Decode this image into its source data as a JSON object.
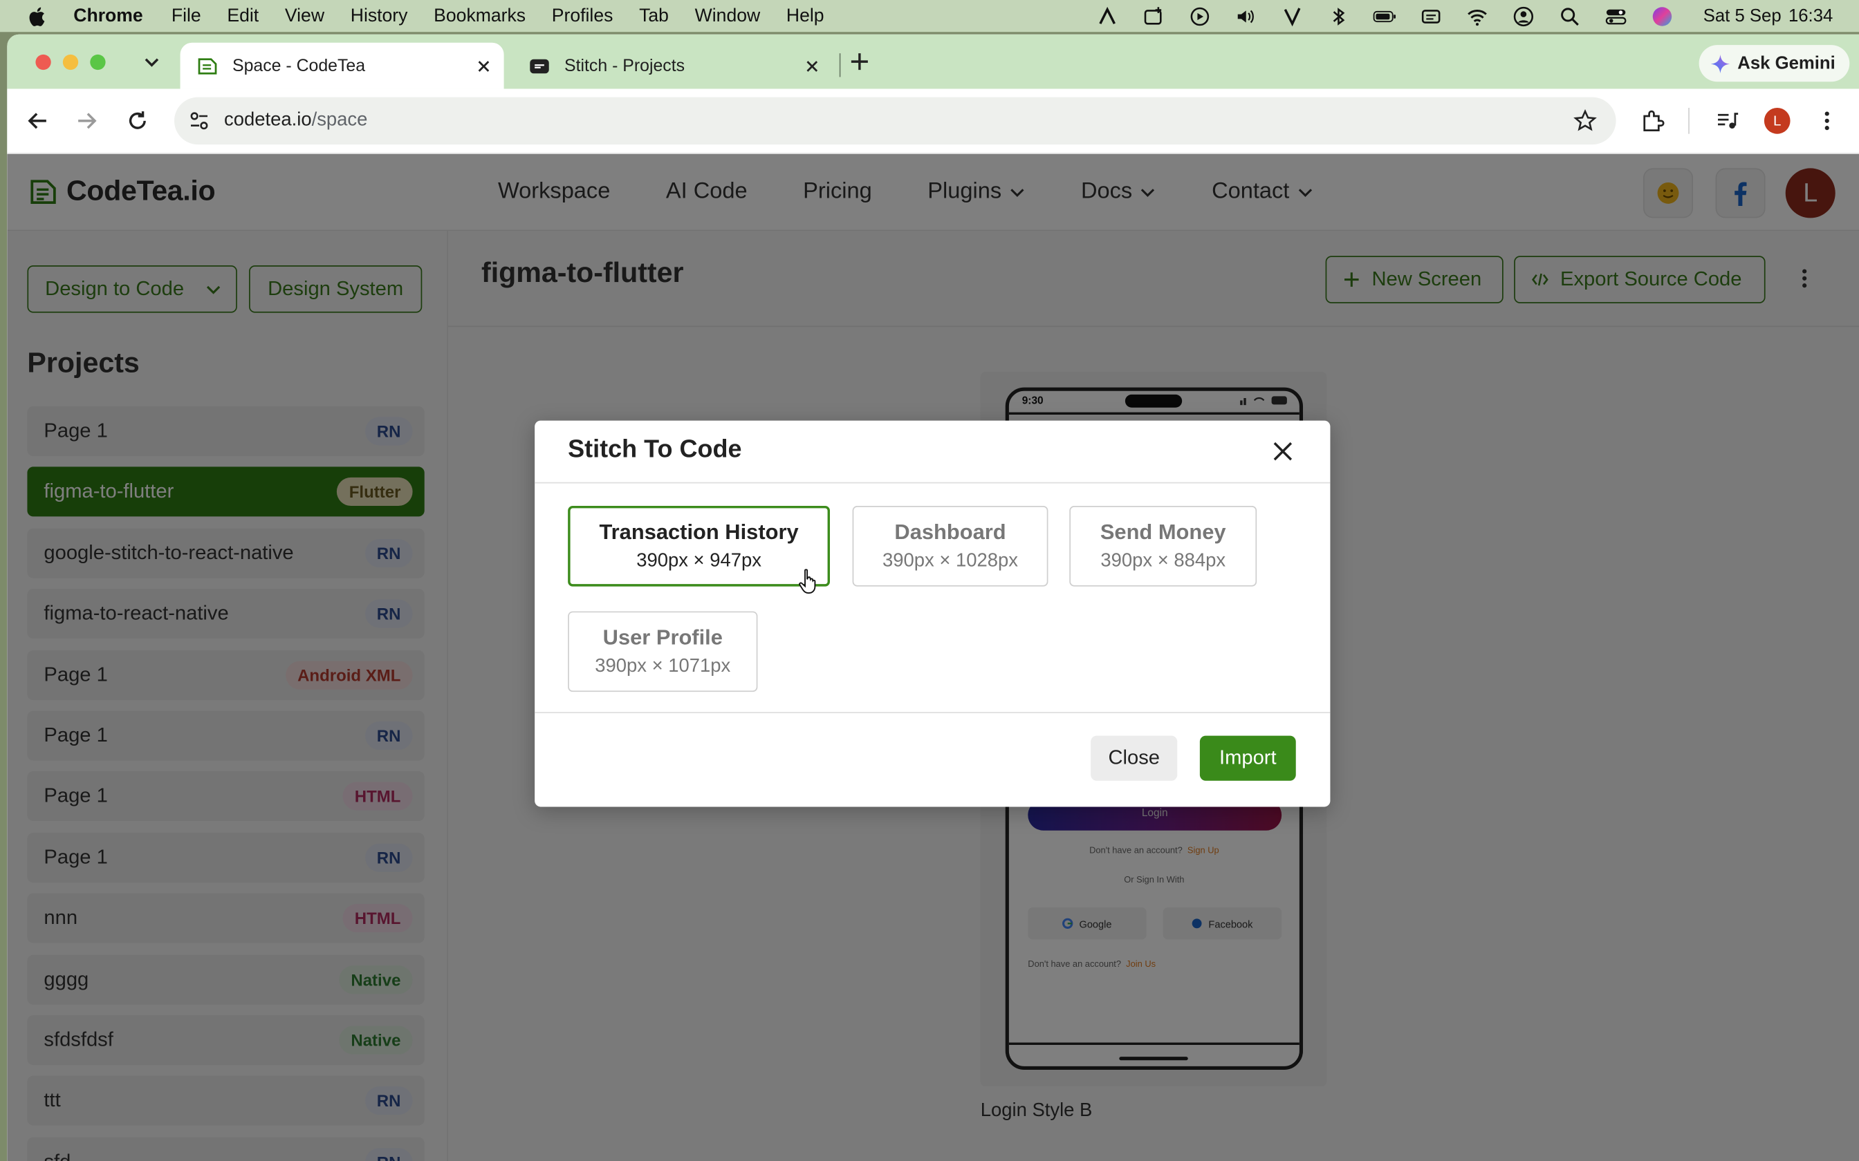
{
  "menubar": {
    "app": "Chrome",
    "items": [
      "File",
      "Edit",
      "View",
      "History",
      "Bookmarks",
      "Profiles",
      "Tab",
      "Window",
      "Help"
    ],
    "date": "Sat 5 Sep",
    "time": "16:34"
  },
  "browser": {
    "tabs": [
      {
        "title": "Space - CodeTea",
        "active": true
      },
      {
        "title": "Stitch - Projects",
        "active": false
      }
    ],
    "gemini_label": "Ask Gemini",
    "url_host": "codetea.io",
    "url_path": "/space",
    "profile_initial": "L"
  },
  "site": {
    "logo": "CodeTea.io",
    "nav": [
      "Workspace",
      "AI Code",
      "Pricing",
      "Plugins",
      "Docs",
      "Contact"
    ],
    "avatar_initial": "L"
  },
  "sidebar": {
    "design_to_code": "Design to Code",
    "design_system": "Design System",
    "projects_title": "Projects",
    "projects": [
      {
        "name": "Page 1",
        "badge": "RN",
        "kind": "rn"
      },
      {
        "name": "figma-to-flutter",
        "badge": "Flutter",
        "kind": "flutter",
        "active": true
      },
      {
        "name": "google-stitch-to-react-native",
        "badge": "RN",
        "kind": "rn"
      },
      {
        "name": "figma-to-react-native",
        "badge": "RN",
        "kind": "rn"
      },
      {
        "name": "Page 1",
        "badge": "Android XML",
        "kind": "xml"
      },
      {
        "name": "Page 1",
        "badge": "RN",
        "kind": "rn"
      },
      {
        "name": "Page 1",
        "badge": "HTML",
        "kind": "html"
      },
      {
        "name": "Page 1",
        "badge": "RN",
        "kind": "rn"
      },
      {
        "name": "nnn",
        "badge": "HTML",
        "kind": "html"
      },
      {
        "name": "gggg",
        "badge": "Native",
        "kind": "native"
      },
      {
        "name": "sfdsfdsf",
        "badge": "Native",
        "kind": "native"
      },
      {
        "name": "ttt",
        "badge": "RN",
        "kind": "rn"
      },
      {
        "name": "sfd",
        "badge": "RN",
        "kind": "rn"
      }
    ]
  },
  "main": {
    "title": "figma-to-flutter",
    "new_screen": "New Screen",
    "export": "Export Source Code",
    "card_label": "Login Style B",
    "phone": {
      "time": "9:30",
      "login": "Login",
      "no_account": "Don't have an account?",
      "sign_up": "Sign Up",
      "or_sign_in": "Or Sign In With",
      "google": "Google",
      "facebook": "Facebook",
      "no_account2": "Don't have an account?",
      "join_us": "Join Us"
    }
  },
  "modal": {
    "title": "Stitch To Code",
    "screens": [
      {
        "name": "Transaction History",
        "dims": "390px × 947px",
        "selected": true
      },
      {
        "name": "Dashboard",
        "dims": "390px × 1028px"
      },
      {
        "name": "Send Money",
        "dims": "390px × 884px"
      },
      {
        "name": "User Profile",
        "dims": "390px × 1071px"
      }
    ],
    "close": "Close",
    "import": "Import"
  },
  "colors": {
    "accent": "#3a8a1a",
    "active_project": "#2f7d12"
  }
}
